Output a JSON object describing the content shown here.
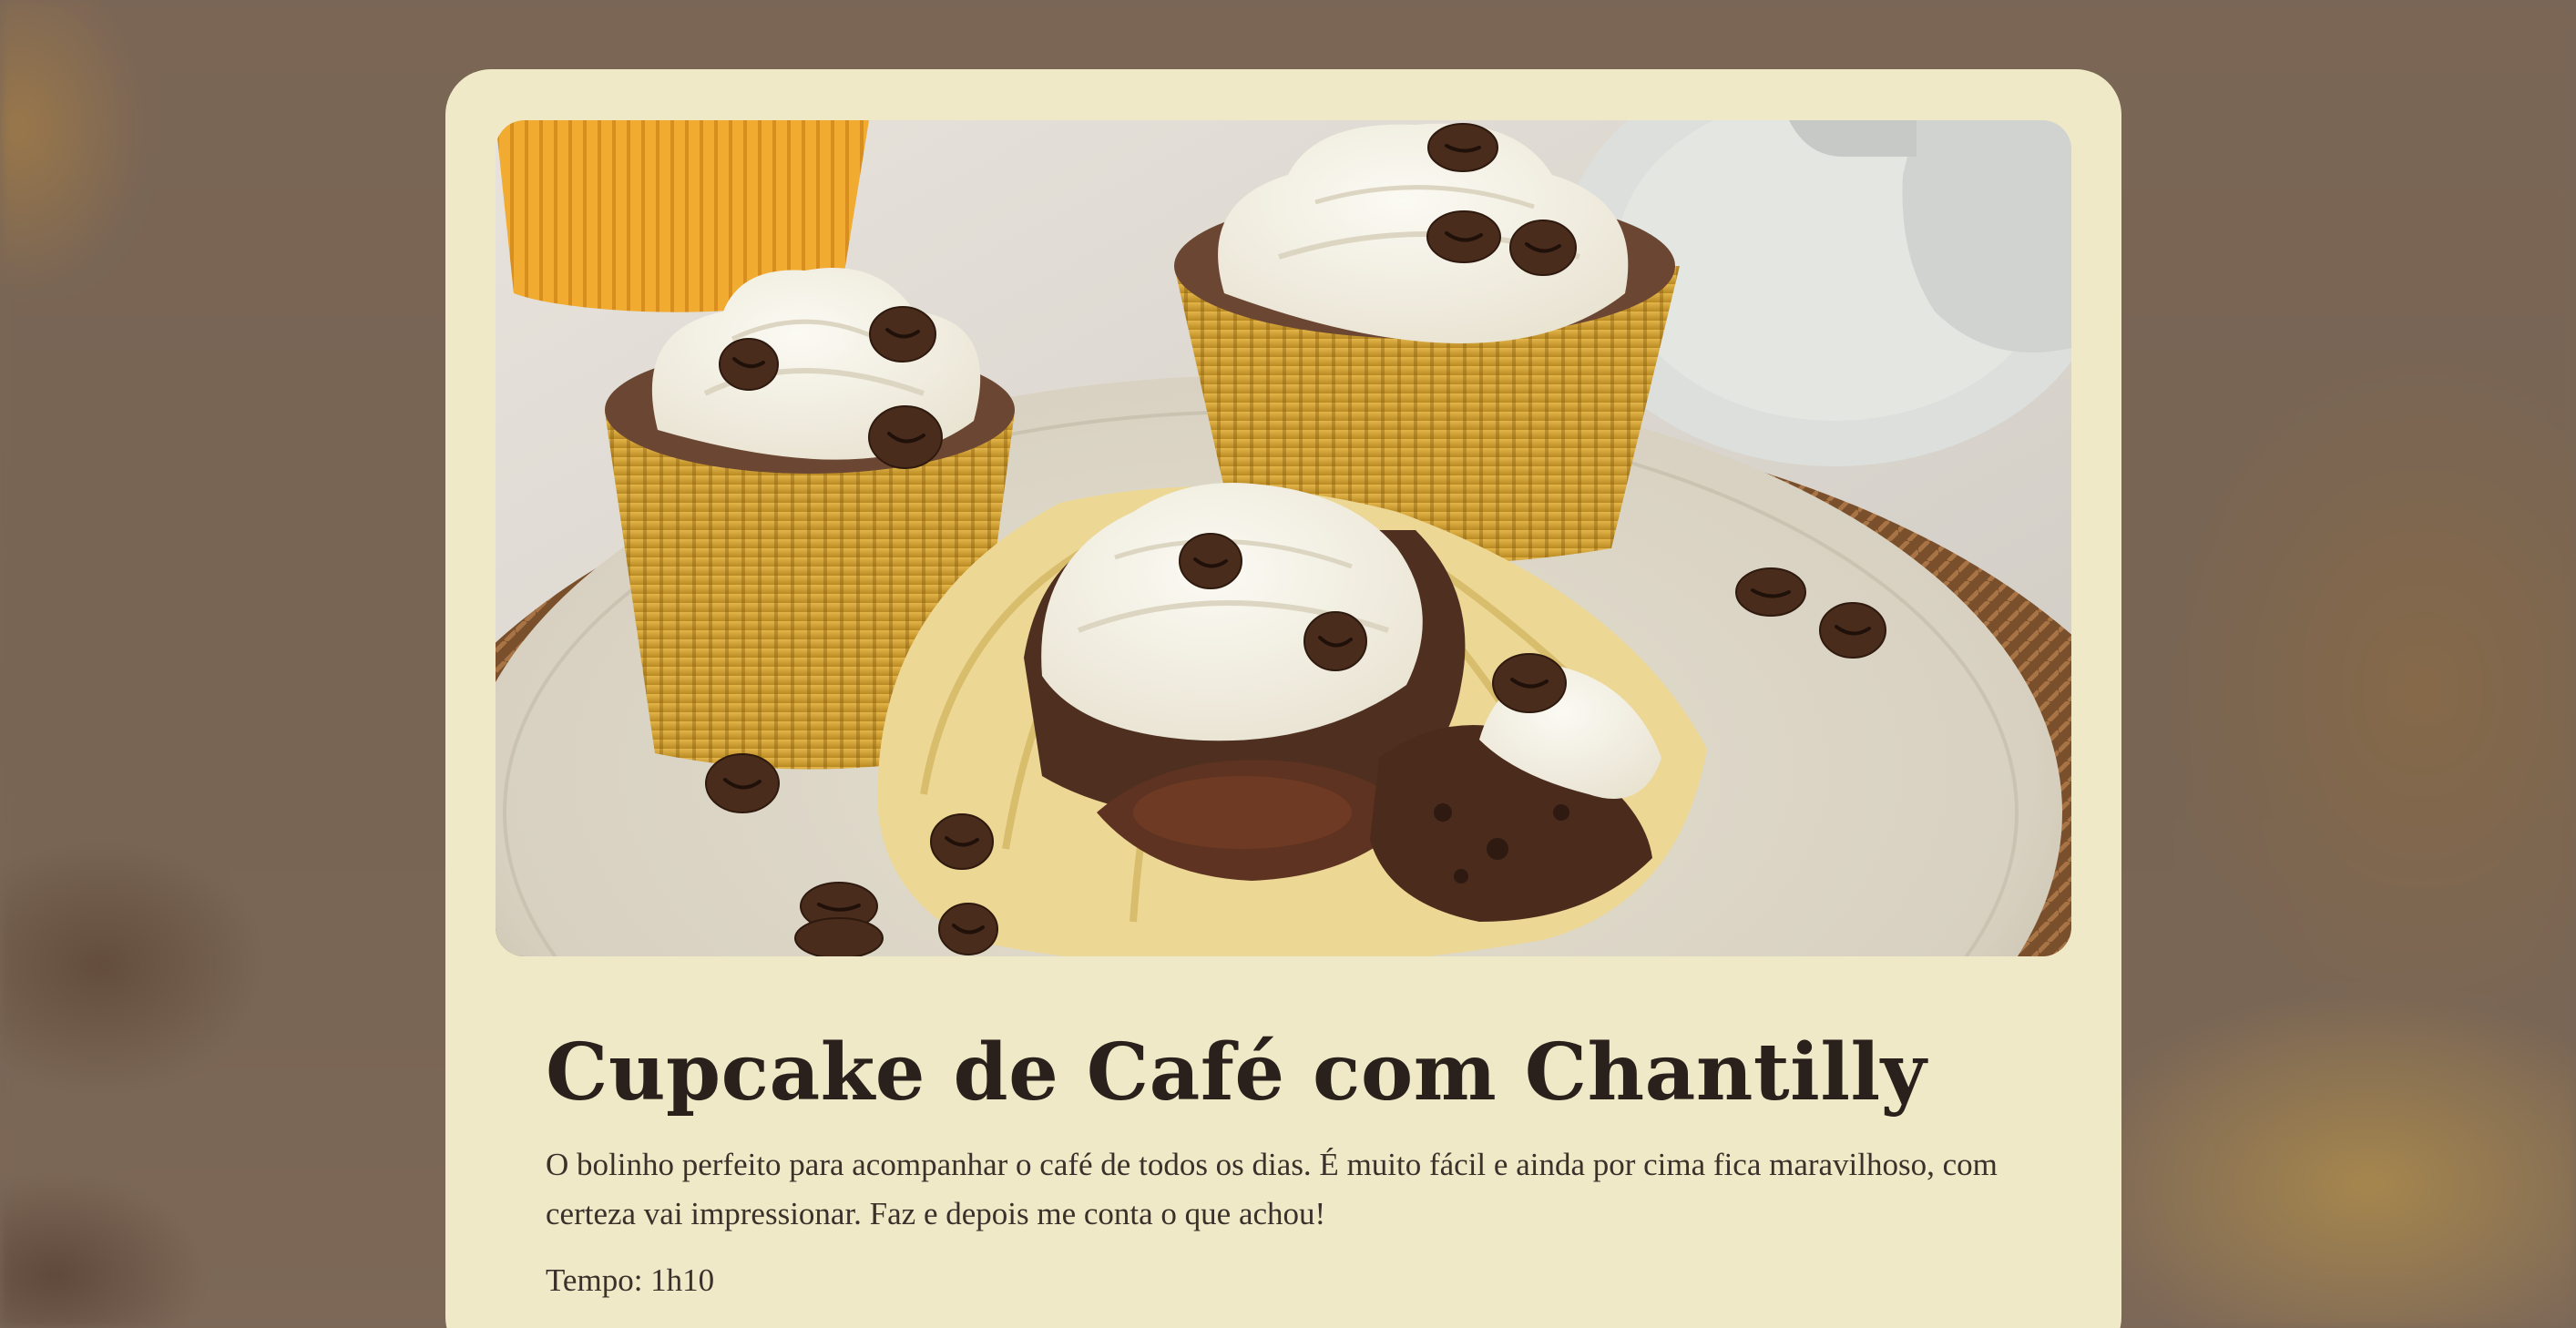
{
  "recipe": {
    "title": "Cupcake de Café com Chantilly",
    "description": "O bolinho perfeito para acompanhar o café de todos os dias. É muito fácil e ainda por cima fica maravilhoso, com certeza vai impressionar. Faz e depois me conta o que achou!",
    "time_label": "Tempo: 1h10",
    "image_subject": "coffee cupcakes with whipped cream and coffee beans on a plate"
  },
  "colors": {
    "background": "#7a6757",
    "card": "#f0e9c8",
    "text": "#2a211c"
  }
}
